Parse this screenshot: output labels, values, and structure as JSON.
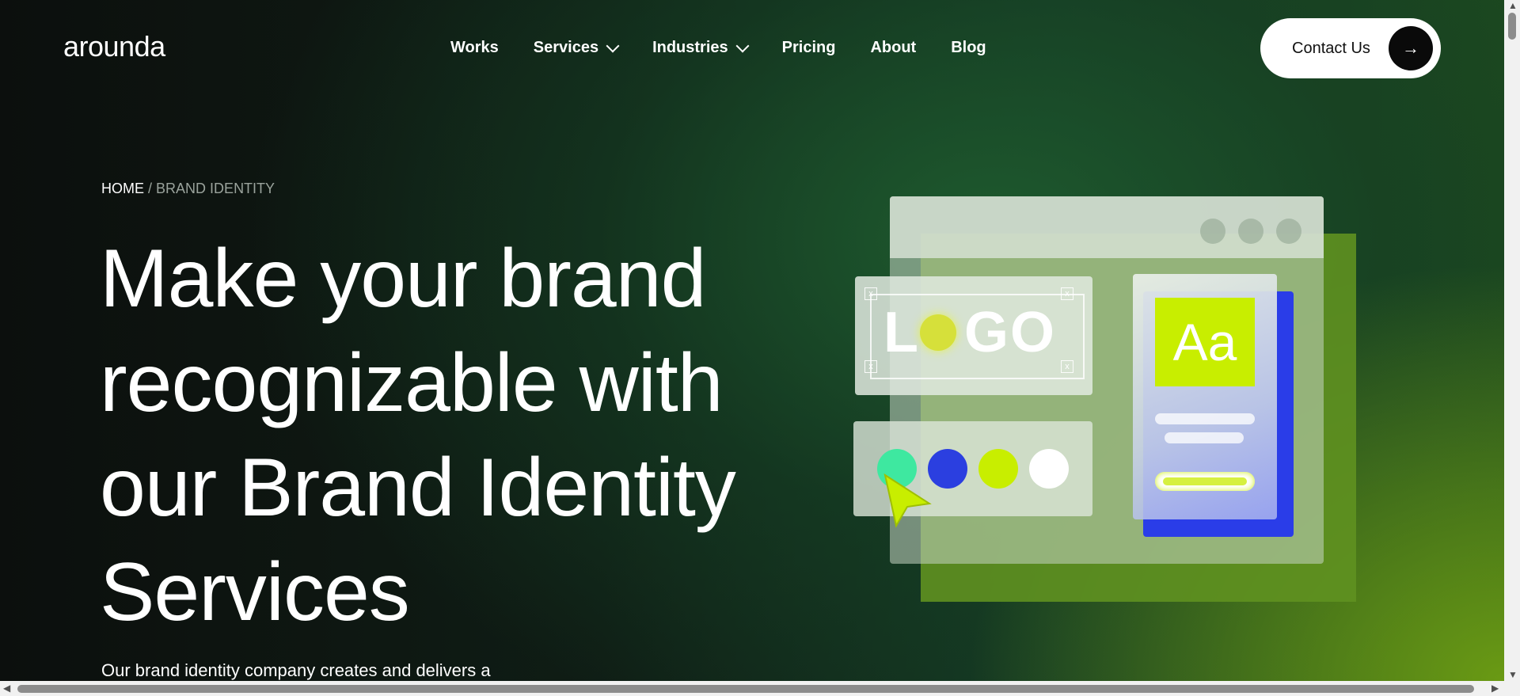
{
  "header": {
    "logo": "arounda",
    "nav": [
      {
        "label": "Works",
        "has_dropdown": false
      },
      {
        "label": "Services",
        "has_dropdown": true
      },
      {
        "label": "Industries",
        "has_dropdown": true
      },
      {
        "label": "Pricing",
        "has_dropdown": false
      },
      {
        "label": "About",
        "has_dropdown": false
      },
      {
        "label": "Blog",
        "has_dropdown": false
      }
    ],
    "contact_label": "Contact Us",
    "contact_icon": "arrow-right-icon"
  },
  "breadcrumb": {
    "home": "HOME",
    "separator": "/",
    "current": "BRAND IDENTITY"
  },
  "hero": {
    "headline_lines": [
      "Make your brand",
      "recognizable with",
      "our Brand Identity",
      "Services"
    ],
    "description": "Our brand identity company creates and delivers a"
  },
  "illustration": {
    "logo_text_left": "L",
    "logo_text_right": "GO",
    "type_sample": "Aa",
    "swatches": [
      "#3ee8a0",
      "#2b3fe0",
      "#c8ee00",
      "#ffffff"
    ],
    "x_mark": "x"
  },
  "colors": {
    "accent_lime": "#c8ee00",
    "accent_blue": "#2a3de8",
    "button_bg": "#ffffff"
  }
}
